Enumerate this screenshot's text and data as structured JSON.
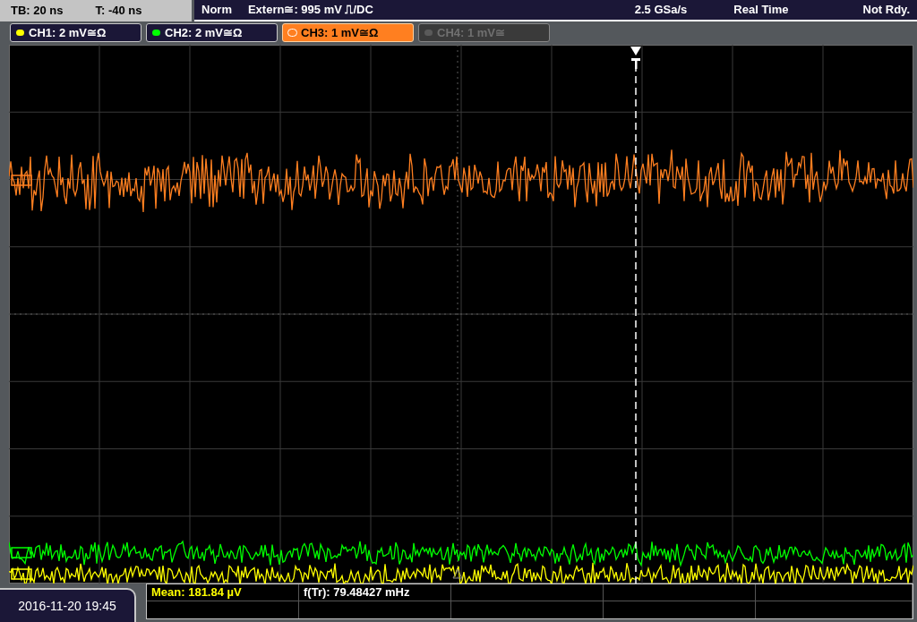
{
  "status_bar": {
    "timebase": "TB: 20 ns",
    "trigger_time": "T: -40 ns",
    "mode": "Norm",
    "trigger_source": "Extern≅: 995 mV ⎍/DC",
    "sample_rate": "2.5 GSa/s",
    "acquisition": "Real Time",
    "state": "Not Rdy."
  },
  "channels": [
    {
      "label": "CH1: 2 mV≅Ω",
      "color": "#ffff00",
      "selected": false,
      "enabled": true
    },
    {
      "label": "CH2: 2 mV≅Ω",
      "color": "#00ff00",
      "selected": false,
      "enabled": true
    },
    {
      "label": "CH3: 1 mV≅Ω",
      "color": "#ff7f20",
      "selected": true,
      "enabled": true
    },
    {
      "label": "CH4: 1 mV≅",
      "color": "#5a5a5a",
      "selected": false,
      "enabled": false
    }
  ],
  "date_time": "2016-11-20 19:45",
  "measurements": [
    {
      "text": "Mean: 181.84 µV",
      "color": "#ffff00"
    },
    {
      "text": "f(Tr): 79.48427 mHz",
      "color": "#ffffff"
    }
  ]
}
